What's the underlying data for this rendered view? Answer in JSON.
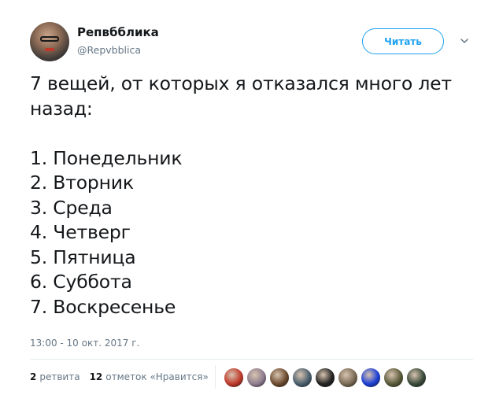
{
  "author": {
    "display_name": "Репвбблика",
    "username": "@Repvbblica"
  },
  "follow_button_label": "Читать",
  "tweet": {
    "lines": [
      "7 вещей, от которых я отказался много лет",
      "назад:",
      "",
      "1. Понедельник",
      "2. Вторник",
      "3. Среда",
      "4. Четверг",
      "5. Пятница",
      "6. Суббота",
      "7. Воскресенье"
    ],
    "timestamp": "13:00 - 10 окт. 2017 г."
  },
  "stats": {
    "retweets_count": "2",
    "retweets_label": "ретвита",
    "likes_count": "12",
    "likes_label": "отметок «Нравится»"
  },
  "liker_avatar_colors": [
    "#c0392b",
    "#8e7d8f",
    "#6b4a2e",
    "#4a5f6e",
    "#222222",
    "#7a6a55",
    "#1a3fd6",
    "#5a5a3a",
    "#3a4a3a"
  ],
  "colors": {
    "accent": "#1da1f2",
    "text": "#14171a",
    "secondary_text": "#657786"
  }
}
